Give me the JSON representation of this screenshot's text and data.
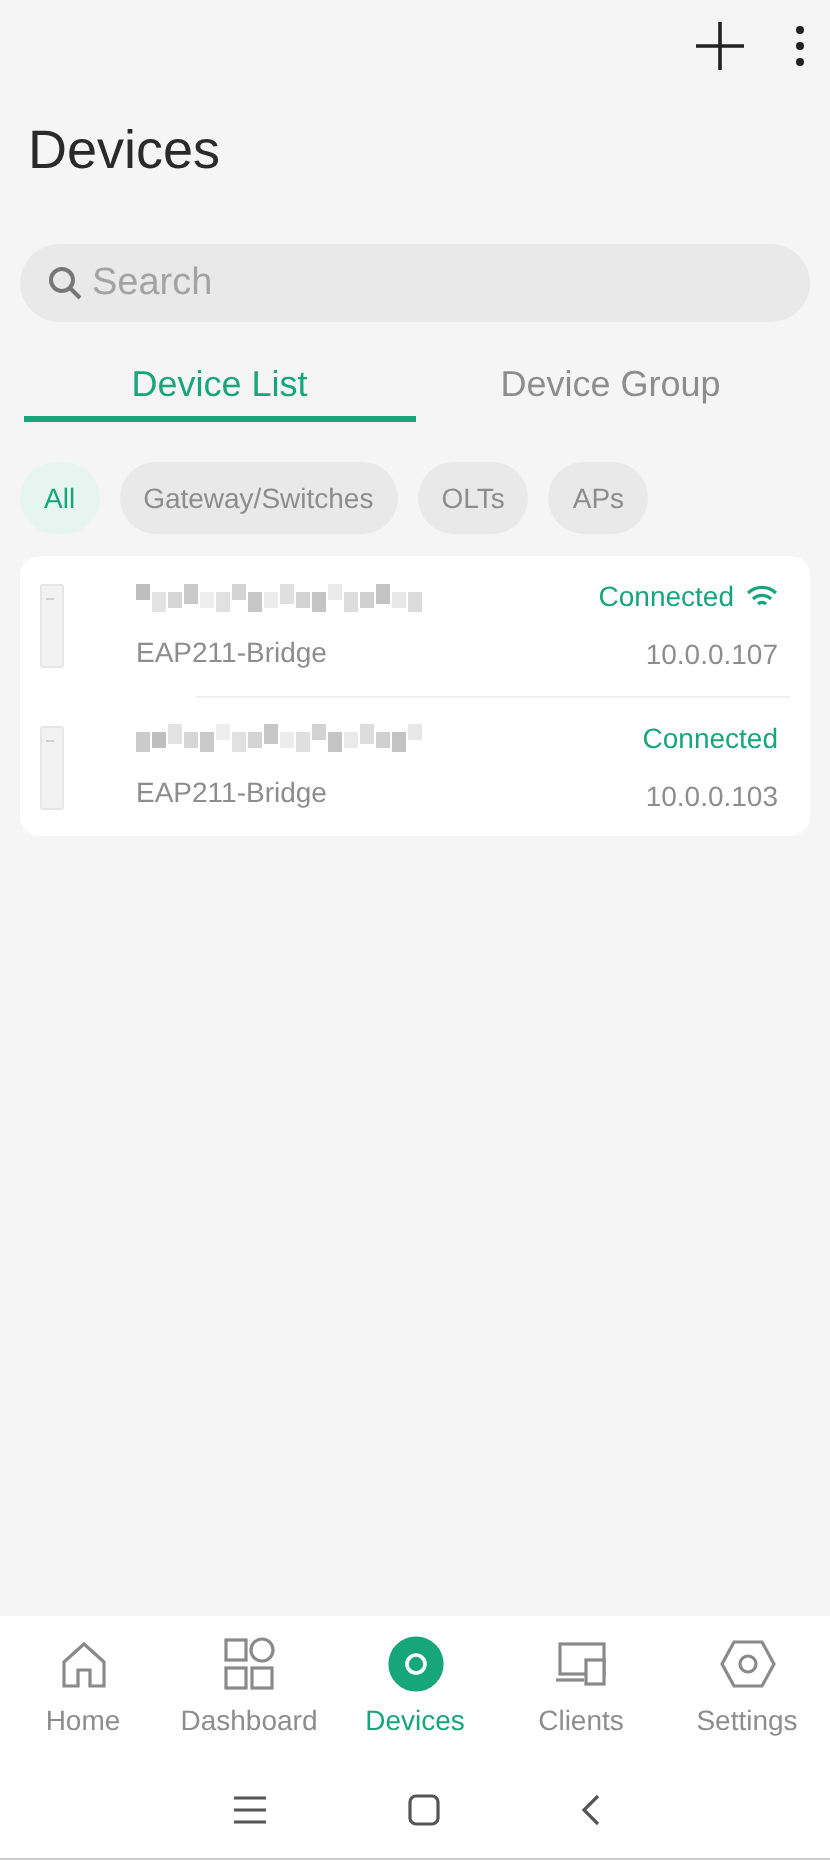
{
  "title": "Devices",
  "search": {
    "placeholder": "Search"
  },
  "tabs": [
    {
      "label": "Device List",
      "selected": true
    },
    {
      "label": "Device Group",
      "selected": false
    }
  ],
  "filters": [
    {
      "label": "All",
      "selected": true
    },
    {
      "label": "Gateway/Switches",
      "selected": false
    },
    {
      "label": "OLTs",
      "selected": false
    },
    {
      "label": "APs",
      "selected": false
    }
  ],
  "devices": [
    {
      "model": "EAP211-Bridge",
      "status": "Connected",
      "ip": "10.0.0.107",
      "wifi": true
    },
    {
      "model": "EAP211-Bridge",
      "status": "Connected",
      "ip": "10.0.0.103",
      "wifi": false
    }
  ],
  "nav": [
    {
      "label": "Home",
      "kind": "home",
      "selected": false
    },
    {
      "label": "Dashboard",
      "kind": "dashboard",
      "selected": false
    },
    {
      "label": "Devices",
      "kind": "devices",
      "selected": true
    },
    {
      "label": "Clients",
      "kind": "clients",
      "selected": false
    },
    {
      "label": "Settings",
      "kind": "settings",
      "selected": false
    }
  ]
}
